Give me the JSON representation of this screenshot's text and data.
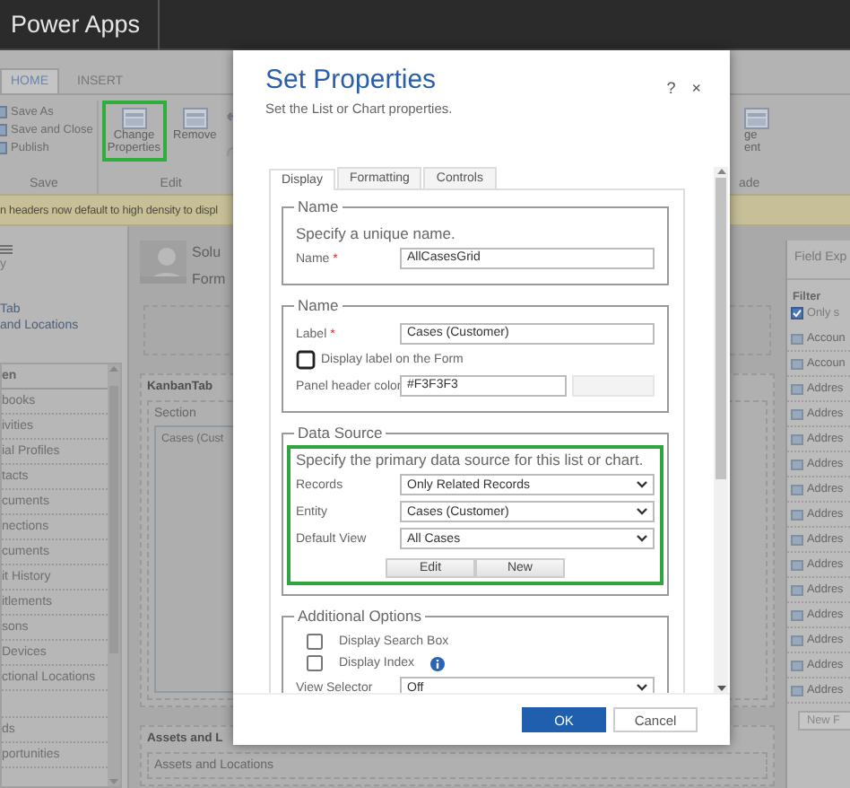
{
  "top_bar": {
    "title": "Power Apps"
  },
  "ribbon": {
    "tabs": [
      {
        "label": "HOME",
        "selected": true
      },
      {
        "label": "INSERT",
        "selected": false
      }
    ],
    "groups": [
      {
        "label": "Save",
        "items": [
          {
            "kind": "small",
            "label": "Save As"
          },
          {
            "kind": "small",
            "label": "Save and Close"
          },
          {
            "kind": "small",
            "label": "Publish"
          }
        ]
      },
      {
        "label": "Edit",
        "items": [
          {
            "kind": "large",
            "label": "Change Properties",
            "highlighted": true
          },
          {
            "kind": "large",
            "label": "Remove",
            "highlighted": false
          },
          {
            "kind": "undo"
          }
        ]
      },
      {
        "label": "ade",
        "items": [
          {
            "kind": "large",
            "label": "ge\nent",
            "highlighted": false
          }
        ]
      }
    ]
  },
  "notice": {
    "text": "n headers now default to high density to displ"
  },
  "left_nav": {
    "upper": [
      "y",
      "Tab",
      "and Locations"
    ],
    "sections": [
      {
        "header": "en",
        "items": [
          "books",
          "ivities",
          "ial Profiles",
          "tacts",
          "cuments",
          "nections",
          "cuments",
          "it History",
          "itlements",
          "sons",
          "Devices",
          "ctional Locations"
        ]
      },
      {
        "items": [
          "ds",
          "portunities"
        ]
      }
    ]
  },
  "form": {
    "header": {
      "title": "Solu",
      "subtitle": "Form"
    },
    "tabs": [
      {
        "title": "KanbanTab",
        "section": "Section",
        "subgrid": "Cases (Cust"
      },
      {
        "title": "Assets and L",
        "section": "Assets and Locations"
      }
    ]
  },
  "field_explorer": {
    "title": "Field Exp",
    "filter_label": "Filter",
    "only_checkbox": {
      "label": "Only s",
      "checked": true
    },
    "fields": [
      "Accoun",
      "Accoun",
      "Addres",
      "Addres",
      "Addres",
      "Addres",
      "Addres",
      "Addres",
      "Addres",
      "Addres",
      "Addres",
      "Addres",
      "Addres",
      "Addres",
      "Addres"
    ],
    "new_button": "New F"
  },
  "dialog": {
    "title": "Set Properties",
    "subtitle": "Set the List or Chart properties.",
    "help": "?",
    "close": "×",
    "tabs": [
      {
        "label": "Display",
        "selected": true
      },
      {
        "label": "Formatting",
        "selected": false
      },
      {
        "label": "Controls",
        "selected": false
      }
    ],
    "sections": [
      {
        "legend": "Name",
        "highlighted": false,
        "intro": "Specify a unique name.",
        "rows": [
          {
            "kind": "text",
            "label": "Name",
            "required_mark": "*",
            "value": "AllCasesGrid"
          }
        ]
      },
      {
        "legend": "Name",
        "highlighted": false,
        "rows": [
          {
            "kind": "text",
            "label": "Label",
            "required_mark": "*",
            "value": "Cases (Customer)"
          },
          {
            "kind": "checkbox",
            "label": "Display label on the Form",
            "checked": false,
            "focused": true,
            "info": false
          },
          {
            "kind": "color",
            "label": "Panel header color",
            "value": "#F3F3F3"
          }
        ]
      },
      {
        "legend": "Data Source",
        "highlighted": true,
        "intro": "Specify the primary data source for this list or chart.",
        "rows": [
          {
            "kind": "select",
            "label": "Records",
            "value": "Only Related Records"
          },
          {
            "kind": "select",
            "label": "Entity",
            "value": "Cases (Customer)"
          },
          {
            "kind": "select",
            "label": "Default View",
            "value": "All Cases"
          },
          {
            "kind": "buttons",
            "buttons": [
              "Edit",
              "New"
            ]
          }
        ]
      },
      {
        "legend": "Additional Options",
        "highlighted": false,
        "rows": [
          {
            "kind": "checkbox",
            "label": "Display Search Box",
            "checked": false,
            "focused": false,
            "info": false
          },
          {
            "kind": "checkbox",
            "label": "Display Index",
            "checked": false,
            "focused": false,
            "info": true
          },
          {
            "kind": "select",
            "label": "View Selector",
            "value": "Off"
          }
        ]
      }
    ],
    "buttons": [
      {
        "label": "OK",
        "primary": true
      },
      {
        "label": "Cancel",
        "primary": false
      }
    ]
  }
}
